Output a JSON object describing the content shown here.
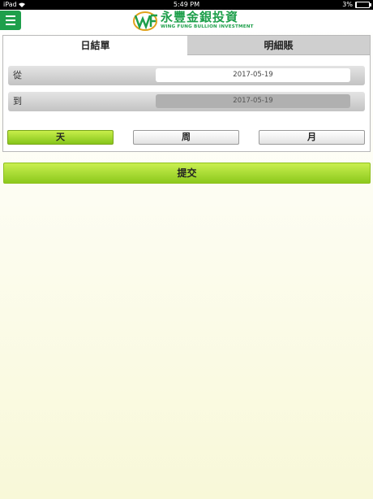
{
  "status_bar": {
    "device": "iPad",
    "time": "5:49 PM",
    "battery": "3%"
  },
  "brand": {
    "chinese": "永豐金銀投資",
    "english": "WING FUNG BULLION INVESTMENT",
    "color": "#1e9f4b"
  },
  "tabs": [
    {
      "label": "日結單",
      "active": true
    },
    {
      "label": "明細賬",
      "active": false
    }
  ],
  "form": {
    "from_label": "從",
    "from_date": "2017-05-19",
    "to_label": "到",
    "to_date": "2017-05-19"
  },
  "period_buttons": [
    {
      "label": "天",
      "active": true
    },
    {
      "label": "周",
      "active": false
    },
    {
      "label": "月",
      "active": false
    }
  ],
  "submit_label": "提交"
}
